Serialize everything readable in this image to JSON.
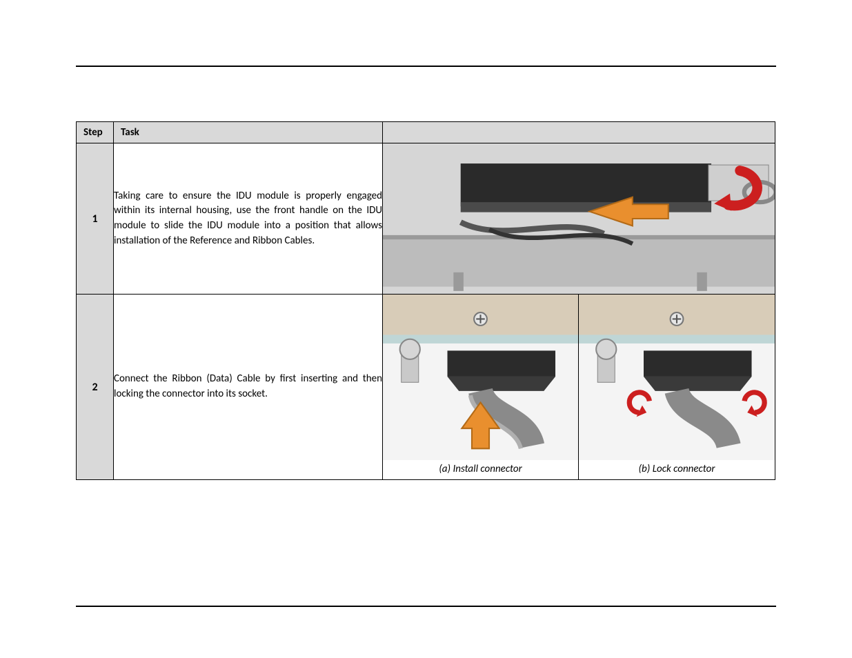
{
  "table": {
    "headers": {
      "step": "Step",
      "task": "Task"
    },
    "rows": [
      {
        "step_no": "1",
        "task": "Taking care to ensure the IDU module is properly engaged within its internal housing, use the front handle on the IDU module to slide the IDU module into a position that allows installation of the Reference and Ribbon Cables.",
        "images": [
          {
            "alt": "IDU module being slid into housing with orange arrow indicating slide direction and red curved arrow indicating handle rotation",
            "caption": ""
          }
        ]
      },
      {
        "step_no": "2",
        "task": "Connect the Ribbon (Data) Cable by first inserting and  then locking the connector into its socket.",
        "images": [
          {
            "alt": "Ribbon cable connector being inserted into socket, orange up-arrow",
            "caption": "(a)  Install connector"
          },
          {
            "alt": "Ribbon cable connector being locked, two small red curved arrows on latches",
            "caption": "(b)  Lock connector"
          }
        ]
      }
    ]
  }
}
